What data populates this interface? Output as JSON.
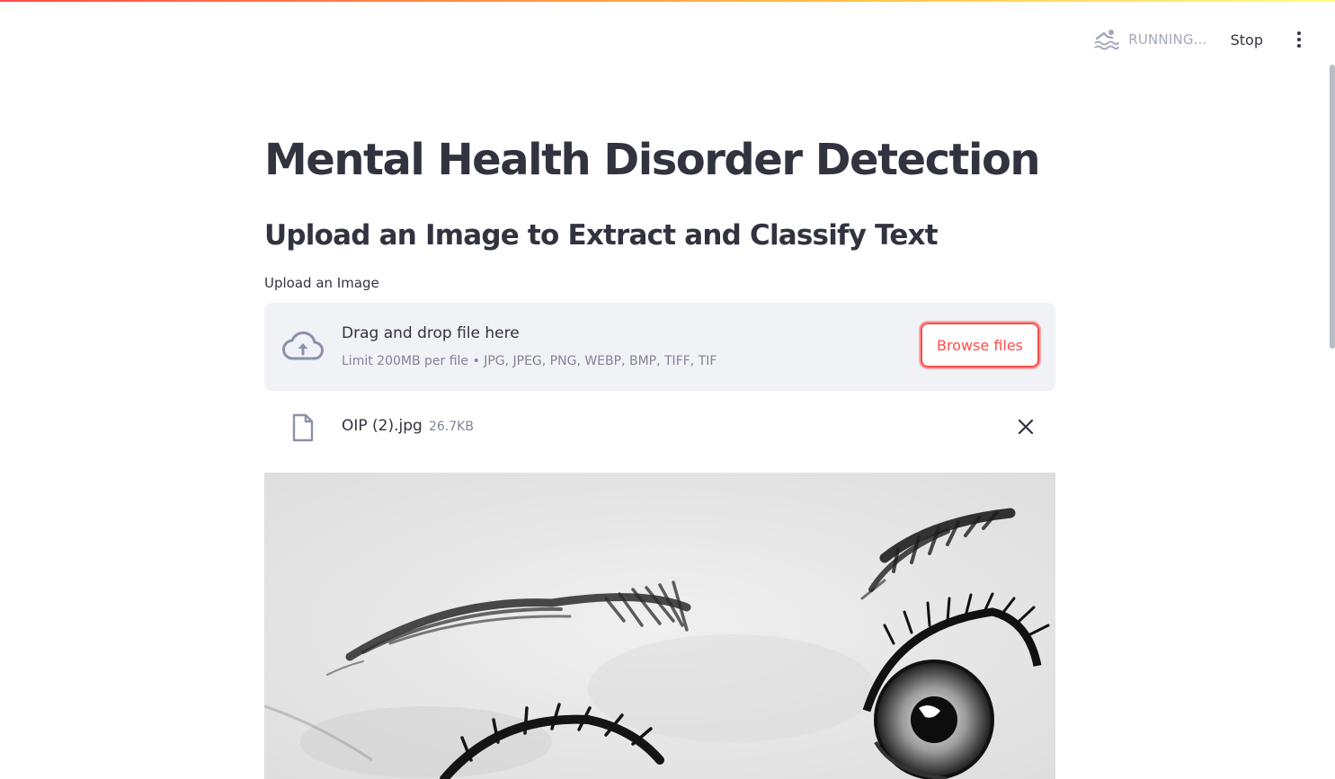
{
  "status": {
    "running_text": "RUNNING...",
    "stop_label": "Stop",
    "running_icon": "swimmer-icon",
    "menu_icon": "vertical-ellipsis-icon"
  },
  "main": {
    "title": "Mental Health Disorder Detection",
    "subheader": "Upload an Image to Extract and Classify Text",
    "uploader": {
      "label": "Upload an Image",
      "drag_text": "Drag and drop file here",
      "limit_text": "Limit 200MB per file • JPG, JPEG, PNG, WEBP, BMP, TIFF, TIF",
      "browse_label": "Browse files",
      "upload_icon": "cloud-upload-icon"
    },
    "uploaded_file": {
      "name": "OIP (2).jpg",
      "size": "26.7KB",
      "icon": "file-icon",
      "remove_icon": "close-icon"
    }
  },
  "colors": {
    "accent": "#ff4b4b",
    "text": "#31333f",
    "muted": "#808495",
    "dropzone_bg": "#f0f2f6"
  }
}
